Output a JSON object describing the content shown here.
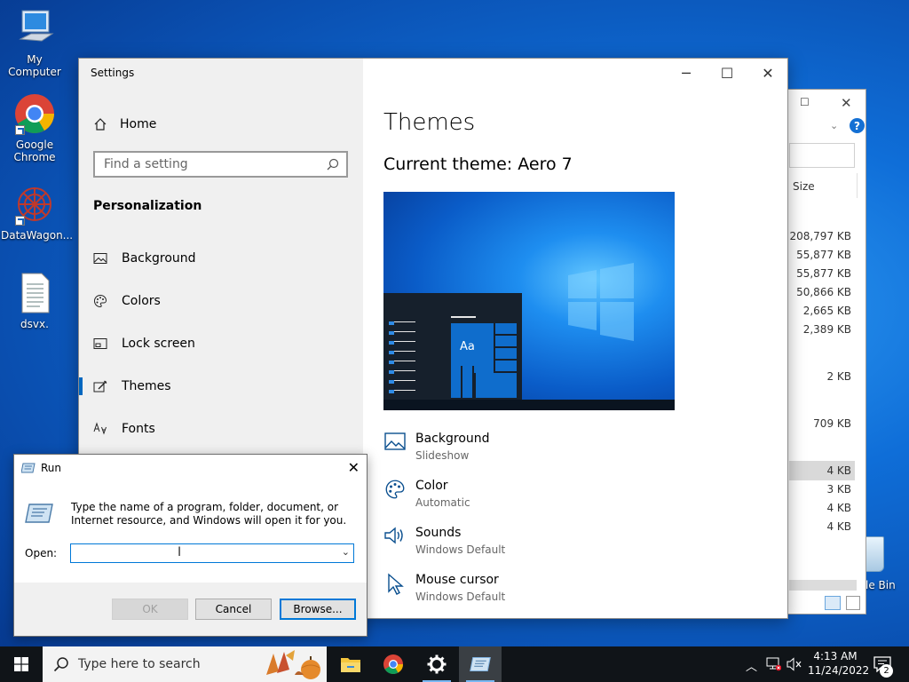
{
  "desktop": {
    "icons": [
      {
        "label": "My Computer"
      },
      {
        "label": "Google Chrome"
      },
      {
        "label": "DataWagon..."
      },
      {
        "label": "dsvx."
      },
      {
        "label": "le Bin"
      }
    ]
  },
  "explorer": {
    "size_header": "Size",
    "sizes": [
      "208,797 KB",
      "55,877 KB",
      "55,877 KB",
      "50,866 KB",
      "2,665 KB",
      "2,389 KB",
      "2 KB",
      "709 KB",
      "4 KB",
      "3 KB",
      "4 KB",
      "4 KB"
    ]
  },
  "settings": {
    "window_title": "Settings",
    "nav": {
      "home": "Home",
      "search_placeholder": "Find a setting",
      "section": "Personalization",
      "items": [
        {
          "label": "Background"
        },
        {
          "label": "Colors"
        },
        {
          "label": "Lock screen"
        },
        {
          "label": "Themes"
        },
        {
          "label": "Fonts"
        }
      ]
    },
    "content": {
      "title": "Themes",
      "current_theme": "Current theme: Aero 7",
      "preview_tile": "Aa",
      "options": [
        {
          "title": "Background",
          "subtitle": "Slideshow"
        },
        {
          "title": "Color",
          "subtitle": "Automatic"
        },
        {
          "title": "Sounds",
          "subtitle": "Windows Default"
        },
        {
          "title": "Mouse cursor",
          "subtitle": "Windows Default"
        }
      ]
    }
  },
  "run_dialog": {
    "title": "Run",
    "description": "Type the name of a program, folder, document, or Internet resource, and Windows will open it for you.",
    "open_label": "Open:",
    "input_value": "",
    "ok": "OK",
    "cancel": "Cancel",
    "browse": "Browse..."
  },
  "taskbar": {
    "search_placeholder": "Type here to search",
    "time": "4:13 AM",
    "date": "11/24/2022",
    "notification_count": "2"
  },
  "colors": {
    "accent": "#0078d7",
    "taskbar": "#101418"
  }
}
